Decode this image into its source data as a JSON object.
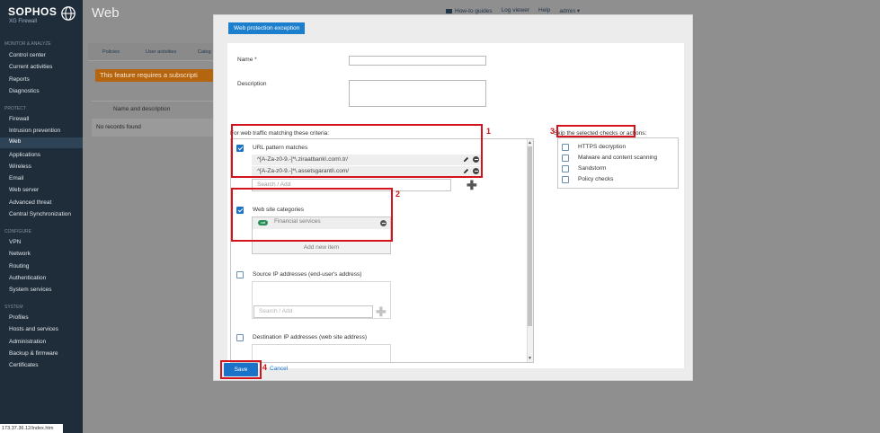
{
  "sidebar": {
    "brand": "SOPHOS",
    "product": "XG Firewall",
    "sections": [
      {
        "title": "MONITOR & ANALYZE",
        "items": [
          "Control center",
          "Current activities",
          "Reports",
          "Diagnostics"
        ]
      },
      {
        "title": "PROTECT",
        "items": [
          "Firewall",
          "Intrusion prevention",
          "Web",
          "Applications",
          "Wireless",
          "Email",
          "Web server",
          "Advanced threat",
          "Central Synchronization"
        ]
      },
      {
        "title": "CONFIGURE",
        "items": [
          "VPN",
          "Network",
          "Routing",
          "Authentication",
          "System services"
        ]
      },
      {
        "title": "SYSTEM",
        "items": [
          "Profiles",
          "Hosts and services",
          "Administration",
          "Backup & firmware",
          "Certificates"
        ]
      }
    ],
    "active_item": "Web"
  },
  "status_bar": {
    "url": "173.37.36.12/index.htm"
  },
  "header": {
    "title": "Web",
    "links": {
      "how_to": "How-to guides",
      "log_viewer": "Log viewer",
      "help": "Help",
      "admin": "admin ▾"
    }
  },
  "background": {
    "tabs": [
      "Policies",
      "User activities",
      "Categ"
    ],
    "banner": "This feature requires a subscripti",
    "table_header": "Name and description",
    "empty_row": "No records found"
  },
  "modal": {
    "tab_title": "Web protection exception",
    "name_label": "Name *",
    "name_value": "",
    "description_label": "Description",
    "description_value": "",
    "criteria_label": "For web traffic matching these criteria:",
    "url_patterns": {
      "label": "URL pattern matches",
      "checked": true,
      "items": [
        "^[A-Za-z0-9.-]*\\.ziraatbank\\.com\\.tr/",
        "^[A-Za-z0-9.-]*\\.assetsgaranti\\.com/"
      ],
      "search_placeholder": "Search / Add"
    },
    "categories": {
      "label": "Web site categories",
      "checked": true,
      "tag": "cat",
      "items": [
        "Financial services"
      ],
      "add_label": "Add new item"
    },
    "source_ip": {
      "label": "Source IP addresses (end-user's address)",
      "checked": false,
      "search_placeholder": "Search / Add"
    },
    "dest_ip": {
      "label": "Destination IP addresses (web site address)",
      "checked": false
    },
    "skip_label": "Skip the selected checks or actions:",
    "skip_items": [
      {
        "label": "HTTPS decryption",
        "checked": false
      },
      {
        "label": "Malware and content scanning",
        "checked": false
      },
      {
        "label": "Sandstorm",
        "checked": false
      },
      {
        "label": "Policy checks",
        "checked": false
      }
    ],
    "save_label": "Save",
    "cancel_label": "Cancel"
  },
  "annotations": [
    "1",
    "2",
    "3",
    "4"
  ],
  "colors": {
    "accent": "#1b73c9",
    "highlight": "#d4141c",
    "sidebar": "#1f2d3a",
    "banner": "#b5640f"
  }
}
